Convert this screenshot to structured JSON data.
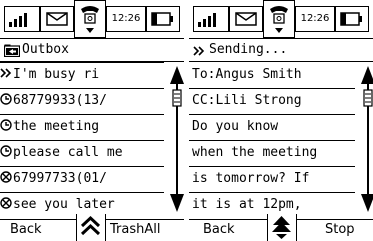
{
  "status_bar": {
    "time": "12:26"
  },
  "outbox_screen": {
    "title": "Outbox",
    "items": [
      {
        "icon": "double-chevron-icon",
        "text": "I'm busy ri"
      },
      {
        "icon": "clock-icon",
        "text": "68779933(13/"
      },
      {
        "icon": "clock-icon",
        "text": "the meeting"
      },
      {
        "icon": "clock-icon",
        "text": "please call me"
      },
      {
        "icon": "failed-icon",
        "text": "67997733(01/"
      },
      {
        "icon": "failed-icon",
        "text": "see you later"
      }
    ],
    "softkeys": {
      "left": "Back",
      "right": "TrashAll"
    }
  },
  "sending_screen": {
    "title": "Sending...",
    "title_icon": "double-chevron-icon",
    "lines": [
      "To:Angus Smith",
      "CC:Lili Strong",
      "Do you know",
      "when the meeting",
      "is tomorrow? If",
      "it is at 12pm,"
    ],
    "softkeys": {
      "left": "Back",
      "right": "Stop"
    }
  }
}
